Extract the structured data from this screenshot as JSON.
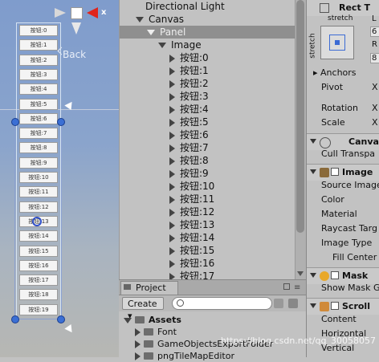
{
  "scene": {
    "gizmo_axis_label": "x",
    "back_label": "Back",
    "buttons": [
      "按钮:0",
      "按钮:1",
      "按钮:2",
      "按钮:3",
      "按钮:4",
      "按钮:5",
      "按钮:6",
      "按钮:7",
      "按钮:8",
      "按钮:9",
      "按钮:10",
      "按钮:11",
      "按钮:12",
      "按钮:13",
      "按钮:14",
      "按钮:15",
      "按钮:16",
      "按钮:17",
      "按钮:18",
      "按钮:19"
    ]
  },
  "hierarchy": {
    "top_items": [
      "Directional Light",
      "Canvas",
      "Panel",
      "Image"
    ],
    "selected": "Panel",
    "children": [
      "按钮:0",
      "按钮:1",
      "按钮:2",
      "按钮:3",
      "按钮:4",
      "按钮:5",
      "按钮:6",
      "按钮:7",
      "按钮:8",
      "按钮:9",
      "按钮:10",
      "按钮:11",
      "按钮:12",
      "按钮:13",
      "按钮:14",
      "按钮:15",
      "按钮:16",
      "按钮:17"
    ]
  },
  "project": {
    "tab_label": "Project",
    "create_label": "Create",
    "root_folder": "Assets",
    "folders": [
      "Font",
      "GameObjectsExportFolder",
      "pngTileMapEditor"
    ]
  },
  "inspector": {
    "rect_transform": {
      "title": "Rect T",
      "stretch_top": "stretch",
      "stretch_side": "stretch",
      "field1": "6",
      "field2": "R",
      "field3": "8"
    },
    "anchors_label": "Anchors",
    "pivot_label": "Pivot",
    "pivot_val": "X",
    "rotation_label": "Rotation",
    "rotation_val": "X",
    "scale_label": "Scale",
    "scale_val": "X",
    "canvas_renderer": {
      "title": "Canva",
      "cull_label": "Cull Transpa"
    },
    "image": {
      "title": "Image",
      "source_label": "Source Image",
      "color_label": "Color",
      "material_label": "Material",
      "raycast_label": "Raycast Targ",
      "type_label": "Image Type",
      "fill_label": "Fill Center"
    },
    "mask": {
      "title": "Mask",
      "show_label": "Show Mask G"
    },
    "scroll": {
      "title": "Scroll",
      "content_label": "Content",
      "horizontal_label": "Horizontal",
      "vertical_label": "Vertical"
    }
  },
  "watermark": "https://blog.csdn.net/qq_30058057",
  "colors": {
    "selection": "#8f8f8f",
    "handle": "#3b6fd4",
    "axis_red": "#e0251b"
  }
}
